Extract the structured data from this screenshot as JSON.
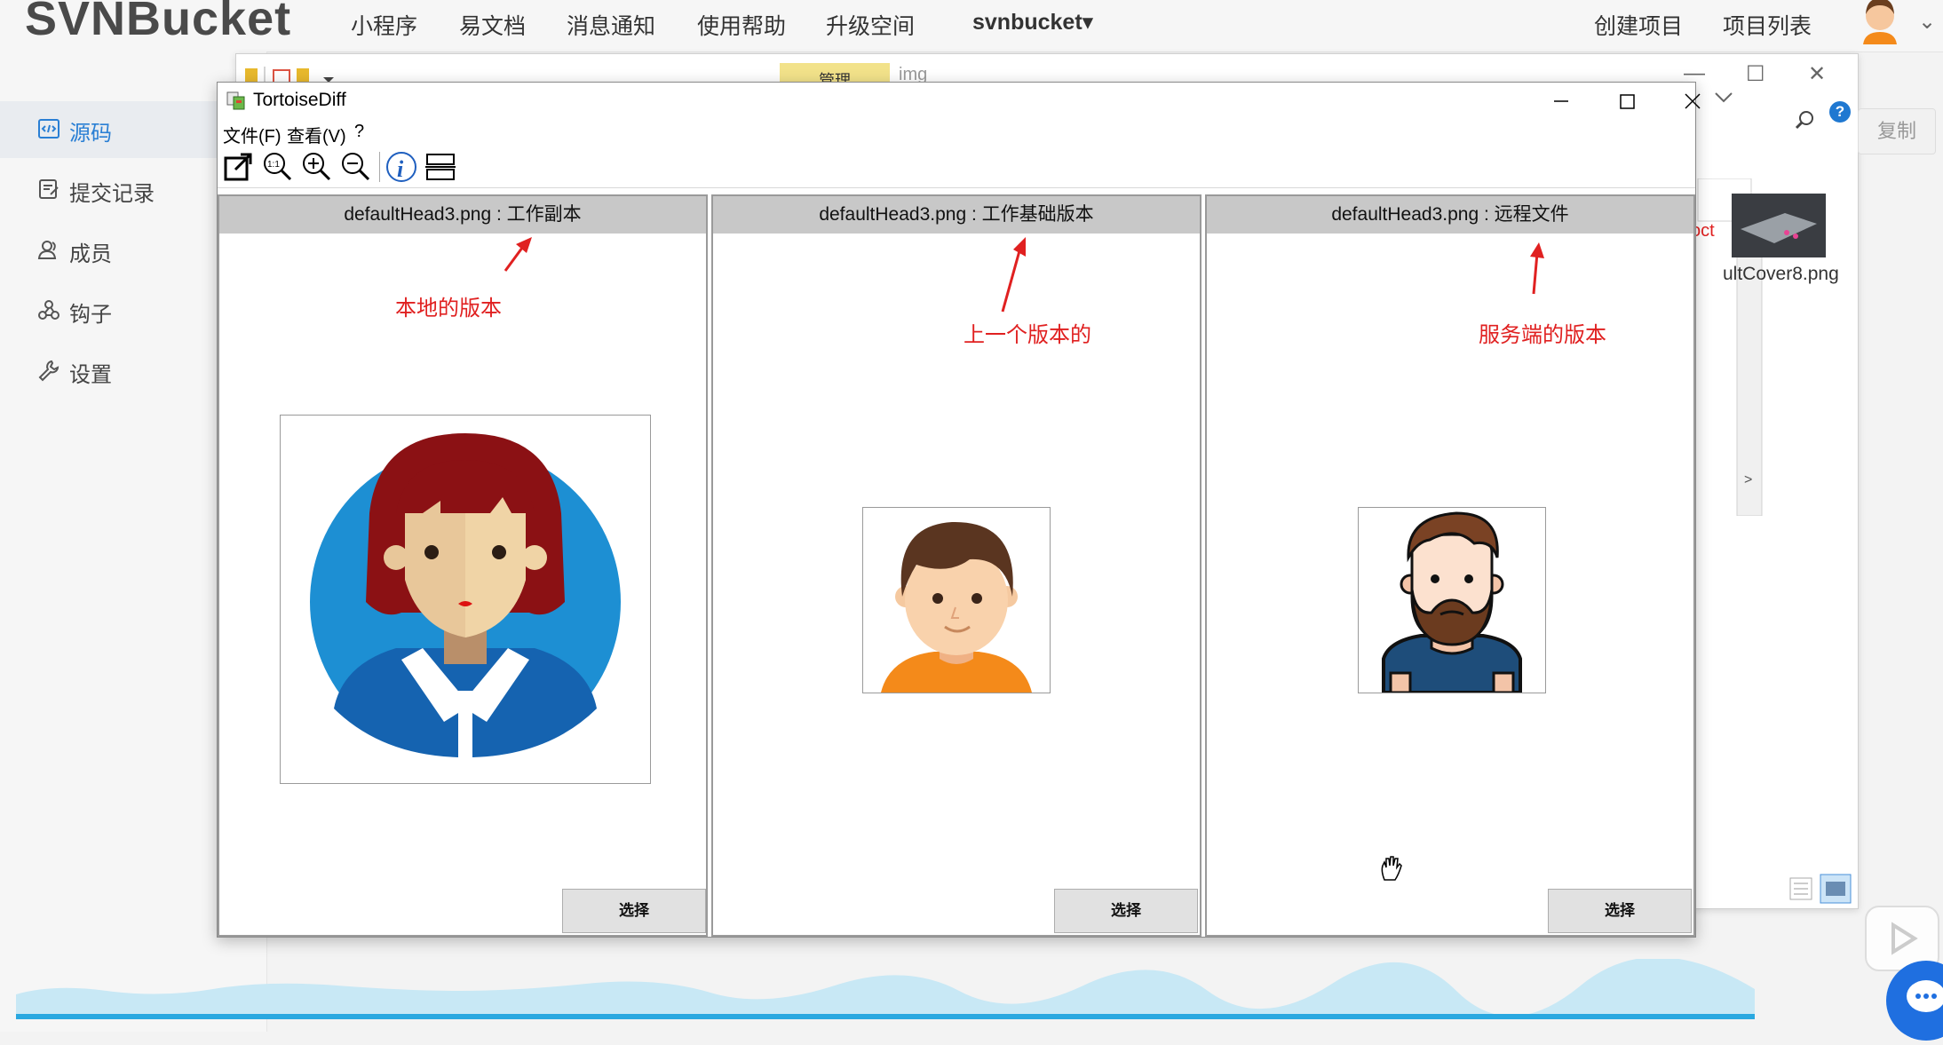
{
  "site": {
    "logo": "SVNBucket",
    "nav": [
      "小程序",
      "易文档",
      "消息通知",
      "使用帮助",
      "升级空间"
    ],
    "user_menu": "svnbucket▾",
    "right_links": [
      "创建项目",
      "项目列表"
    ]
  },
  "sidebar": {
    "items": [
      {
        "label": "源码",
        "icon": "code-icon",
        "active": true
      },
      {
        "label": "提交记录",
        "icon": "commit-log-icon",
        "active": false
      },
      {
        "label": "成员",
        "icon": "members-icon",
        "active": false
      },
      {
        "label": "钩子",
        "icon": "webhook-icon",
        "active": false
      },
      {
        "label": "设置",
        "icon": "wrench-icon",
        "active": false
      }
    ]
  },
  "explorer": {
    "tab_label": "管理",
    "path": "img",
    "copy_button": "复制",
    "help": "?",
    "thumb_label": "ultCover8.png",
    "partial_text": "oct"
  },
  "diff_window": {
    "title": "TortoiseDiff",
    "menu": [
      "文件(F)",
      "查看(V)",
      "?"
    ],
    "toolbar": [
      "open-external-icon",
      "actual-size-icon",
      "zoom-in-icon",
      "zoom-out-icon",
      "info-icon",
      "overlay-icon"
    ],
    "panes": [
      {
        "file": "defaultHead3.png",
        "label": "工作副本",
        "annotation": "本地的版本",
        "button": "选择",
        "image": "woman-avatar-icon"
      },
      {
        "file": "defaultHead3.png",
        "label": "工作基础版本",
        "annotation": "上一个版本的",
        "button": "选择",
        "image": "boy-avatar-icon"
      },
      {
        "file": "defaultHead3.png",
        "label": "远程文件",
        "annotation": "服务端的版本",
        "button": "选择",
        "image": "bearded-man-avatar-icon"
      }
    ]
  },
  "colors": {
    "annotation": "#e02020",
    "accent": "#2a7fd4",
    "pane_header": "#c8c8c8"
  }
}
